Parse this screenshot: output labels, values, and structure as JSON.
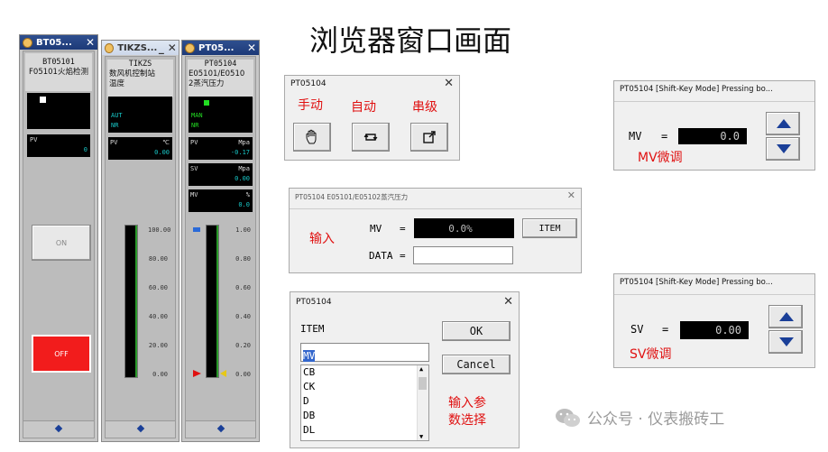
{
  "page_title": "浏览器窗口画面",
  "watermark": "公众号 · 仪表搬砖工",
  "faceplates": [
    {
      "title": "BT05...",
      "tag": "BT05101",
      "desc": "F05101火焰检测",
      "pv_label": "PV",
      "pv_value": "0",
      "on_label": "ON",
      "off_label": "OFF"
    },
    {
      "title": "TIKZS...",
      "tag": "TIKZS",
      "desc1": "数风机控制站",
      "desc2": "温度",
      "mode1": "AUT",
      "mode2": "NR",
      "pv_label": "PV",
      "pv_unit": "℃",
      "pv_value": "0.00",
      "scale": [
        "100.00",
        "80.00",
        "60.00",
        "40.00",
        "20.00",
        "0.00"
      ]
    },
    {
      "title": "PT05...",
      "tag": "PT05104",
      "desc1": "E05101/E0510",
      "desc2": "2蒸汽压力",
      "mode1": "MAN",
      "mode2": "NR",
      "pv_label": "PV",
      "pv_unit": "Mpa",
      "pv_value": "-0.17",
      "sv_label": "SV",
      "sv_unit": "Mpa",
      "sv_value": "0.00",
      "mv_label": "MV",
      "mv_unit": "%",
      "mv_value": "0.0",
      "scale": [
        "1.00",
        "0.80",
        "0.60",
        "0.40",
        "0.20",
        "0.00"
      ]
    }
  ],
  "mode_dialog": {
    "title": "PT05104",
    "label_manual": "手动",
    "label_auto": "自动",
    "label_cascade": "串级"
  },
  "input_dialog": {
    "title": "PT05104 E05101/E05102蒸汽压力",
    "label_input": "输入",
    "mv_label": "MV",
    "eq": "=",
    "mv_value": "0.0%",
    "item_button": "ITEM",
    "data_label": "DATA",
    "data_value": ""
  },
  "item_dialog": {
    "title": "PT05104",
    "item_label": "ITEM",
    "item_value": "MV",
    "items": [
      "CB",
      "CK",
      "D",
      "DB",
      "DL"
    ],
    "ok": "OK",
    "cancel": "Cancel",
    "note1": "输入参",
    "note2": "数选择"
  },
  "mv_dialog": {
    "title": "PT05104  [Shift-Key Mode] Pressing bo...",
    "label": "MV",
    "eq": "=",
    "value": "0.0",
    "caption": "MV微调"
  },
  "sv_dialog": {
    "title": "PT05104  [Shift-Key Mode] Pressing bo...",
    "label": "SV",
    "eq": "=",
    "value": "0.00",
    "caption": "SV微调"
  }
}
